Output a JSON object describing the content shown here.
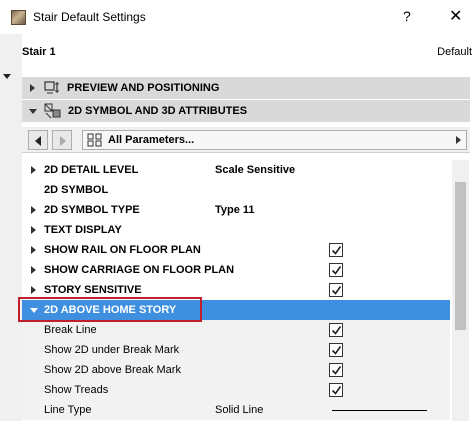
{
  "window": {
    "title": "Stair Default Settings",
    "help": "?",
    "close": "✕"
  },
  "header": {
    "element_name": "Stair 1",
    "default_label": "Default"
  },
  "panels": {
    "preview": "PREVIEW AND POSITIONING",
    "symbol": "2D SYMBOL AND 3D ATTRIBUTES"
  },
  "navbar": {
    "filter_value": "All Parameters..."
  },
  "params": [
    {
      "name": "2D DETAIL LEVEL",
      "value": "Scale Sensitive"
    },
    {
      "name": "2D SYMBOL",
      "value": ""
    },
    {
      "name": "2D SYMBOL TYPE",
      "value": "Type 11"
    },
    {
      "name": "TEXT DISPLAY",
      "value": ""
    },
    {
      "name": "SHOW RAIL ON FLOOR PLAN",
      "checked": true
    },
    {
      "name": "SHOW CARRIAGE ON FLOOR PLAN",
      "checked": true
    },
    {
      "name": "STORY SENSITIVE",
      "checked": true
    },
    {
      "name": "2D ABOVE HOME STORY",
      "selected": true
    },
    {
      "name": "Break Line",
      "checked": true
    },
    {
      "name": "Show 2D under Break Mark",
      "checked": true
    },
    {
      "name": "Show 2D above Break Mark",
      "checked": true
    },
    {
      "name": "Show Treads",
      "checked": true
    },
    {
      "name": "Line Type",
      "value": "Solid Line"
    }
  ],
  "colors": {
    "selection": "#3f8fe0",
    "highlight_box": "#c0202a",
    "panel_header": "#d9d9d9"
  }
}
